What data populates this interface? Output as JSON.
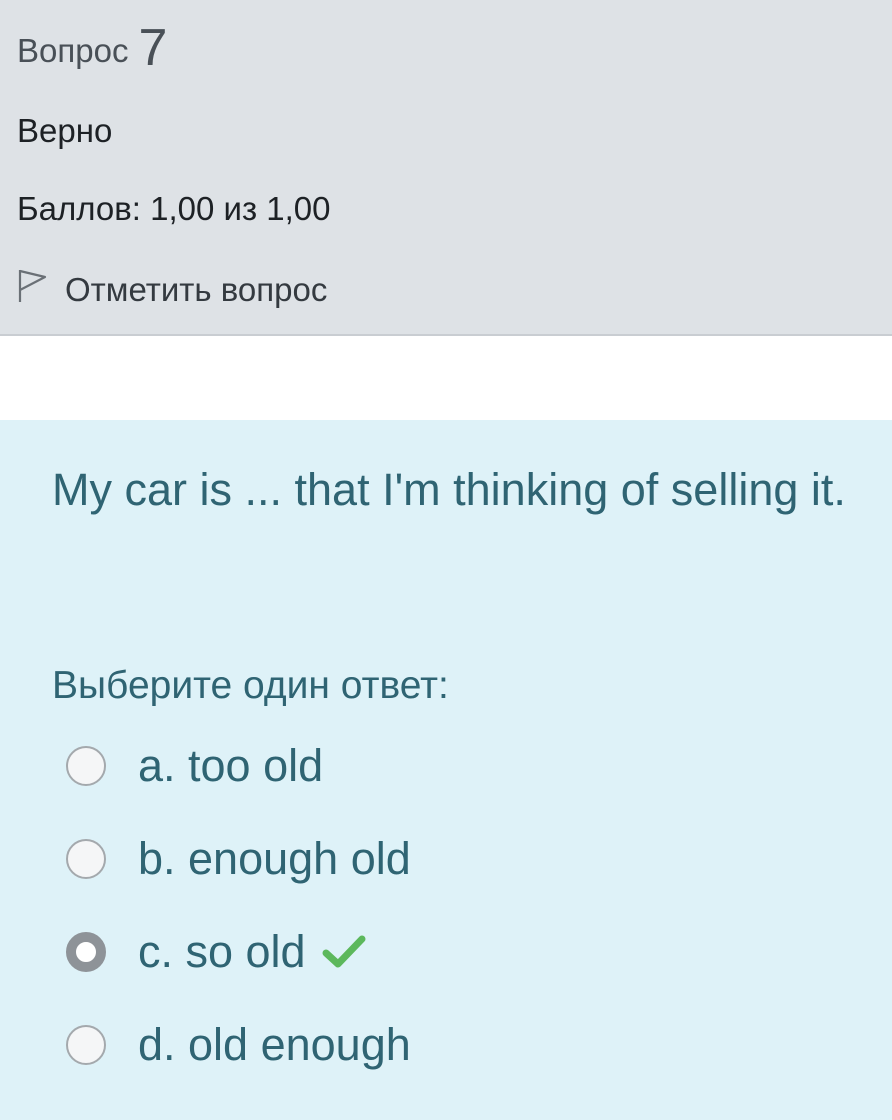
{
  "info": {
    "question_label": "Вопрос",
    "question_number": "7",
    "state": "Верно",
    "grade": "Баллов: 1,00 из 1,00",
    "flag_label": "Отметить вопрос"
  },
  "question": {
    "text": "My car is ... that I'm thinking of selling it.",
    "prompt": "Выберите один ответ:",
    "options": [
      {
        "label": "a. too old",
        "selected": false,
        "correct": false
      },
      {
        "label": "b. enough old",
        "selected": false,
        "correct": false
      },
      {
        "label": "c. so old",
        "selected": true,
        "correct": true
      },
      {
        "label": "d. old enough",
        "selected": false,
        "correct": false
      }
    ]
  },
  "icons": {
    "flag": "flag-icon",
    "correct": "checkmark-icon"
  },
  "colors": {
    "info_bg": "#dee2e6",
    "formulation_bg": "#def2f8",
    "question_text": "#2f6473",
    "correct_check": "#5cb85c"
  }
}
